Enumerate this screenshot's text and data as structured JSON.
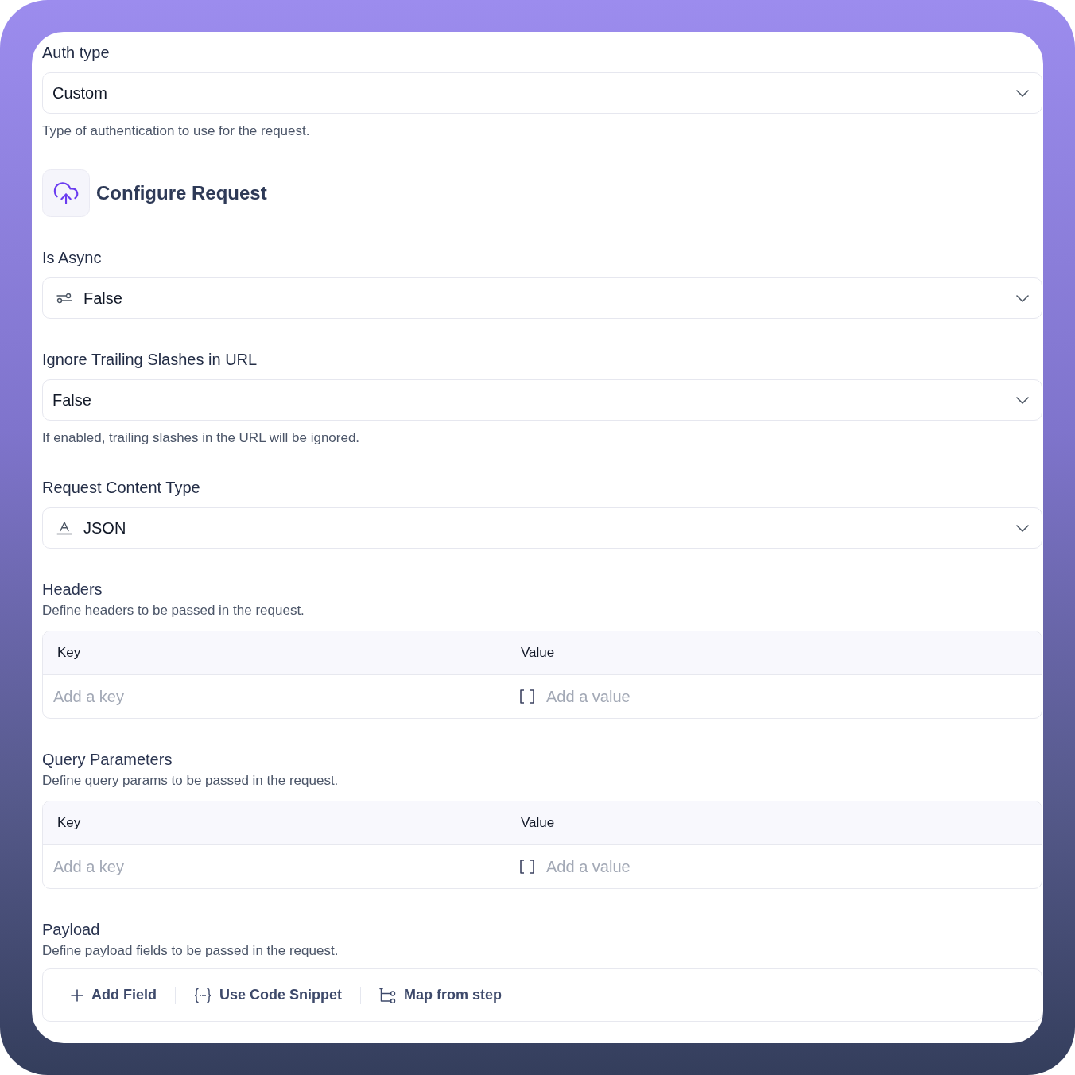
{
  "form": [
    {
      "kind": "select",
      "label": "Auth type",
      "value": "Custom",
      "help": "Type of authentication to use for the request."
    },
    {
      "kind": "heading",
      "title": "Configure Request"
    },
    {
      "kind": "modeselect",
      "label": "Is Async",
      "value": "False"
    },
    {
      "kind": "select",
      "label": "Ignore Trailing Slashes in URL",
      "value": "False",
      "help": "If enabled, trailing slashes in the URL will be ignored."
    },
    {
      "kind": "typeselect",
      "label": "Request Content Type",
      "value": "JSON"
    },
    {
      "kind": "keyvalue",
      "title": "Headers",
      "description": "Define headers to be passed in the request.",
      "columns": [
        "Key",
        "Value"
      ],
      "rows": [
        {
          "key": {
            "placeholder": "Add a key"
          },
          "value": {
            "placeholder": "Add a value"
          }
        }
      ]
    },
    {
      "kind": "keyvalue",
      "title": "Query Parameters",
      "description": "Define query params to be passed in the request.",
      "columns": [
        "Key",
        "Value"
      ],
      "rows": [
        {
          "key": {
            "placeholder": "Add a key"
          },
          "value": {
            "placeholder": "Add a value"
          }
        }
      ]
    },
    {
      "kind": "actions",
      "title": "Payload",
      "description": "Define payload fields to be passed in the request.",
      "actions": [
        {
          "kind": "add",
          "label": "Add Field"
        },
        {
          "kind": "code",
          "label": "Use Code Snippet"
        },
        {
          "kind": "map",
          "label": "Map from step"
        }
      ]
    }
  ]
}
